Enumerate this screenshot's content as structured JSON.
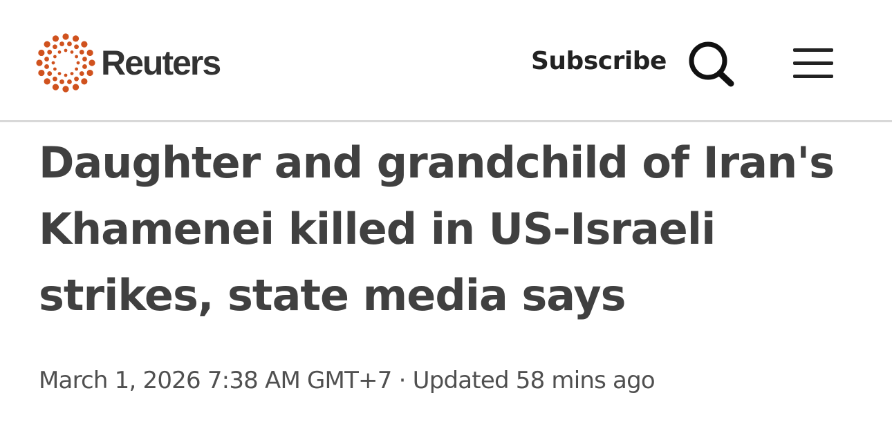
{
  "header": {
    "brand": "Reuters",
    "subscribe_label": "Subscribe",
    "search_icon": "search-icon",
    "menu_icon": "hamburger-menu-icon",
    "logo_icon": "reuters-dot-ring-logo",
    "brand_color": "#D0521E"
  },
  "article": {
    "headline": "Daughter and grandchild of Iran's Khamenei killed in US-Israeli strikes, state media says",
    "published": "March 1, 2026 7:38 AM GMT+7",
    "separator": "·",
    "updated": "Updated 58 mins ago"
  }
}
